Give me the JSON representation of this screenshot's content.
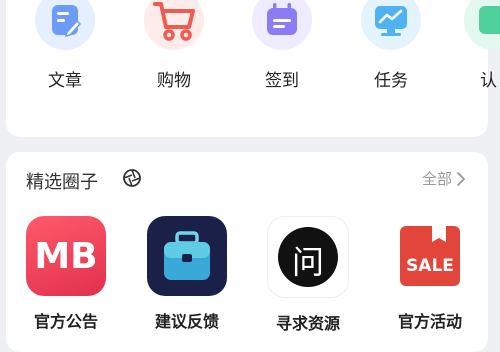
{
  "shortcuts": [
    {
      "label": "文章",
      "icon": "article-icon",
      "color": "#5b8ff9"
    },
    {
      "label": "购物",
      "icon": "shopping-cart-icon",
      "color": "#f05a4f"
    },
    {
      "label": "签到",
      "icon": "checkin-calendar-icon",
      "color": "#7c6cf2"
    },
    {
      "label": "任务",
      "icon": "task-monitor-icon",
      "color": "#3aa6f0"
    },
    {
      "label": "认",
      "icon": "partial-icon",
      "color": "#36c48a"
    }
  ],
  "circles_section": {
    "title": "精选圈子",
    "title_icon": "aperture-icon",
    "all_label": "全部",
    "items": [
      {
        "label": "官方公告",
        "icon": "mb-logo-icon",
        "logo_text": "MB",
        "color": "#f0435c"
      },
      {
        "label": "建议反馈",
        "icon": "briefcase-icon",
        "color": "#1c2450"
      },
      {
        "label": "寻求资源",
        "icon": "ask-icon",
        "logo_text": "问",
        "color": "#111111"
      },
      {
        "label": "官方活动",
        "icon": "sale-tag-icon",
        "logo_text": "SALE",
        "color": "#e2463a"
      }
    ]
  }
}
